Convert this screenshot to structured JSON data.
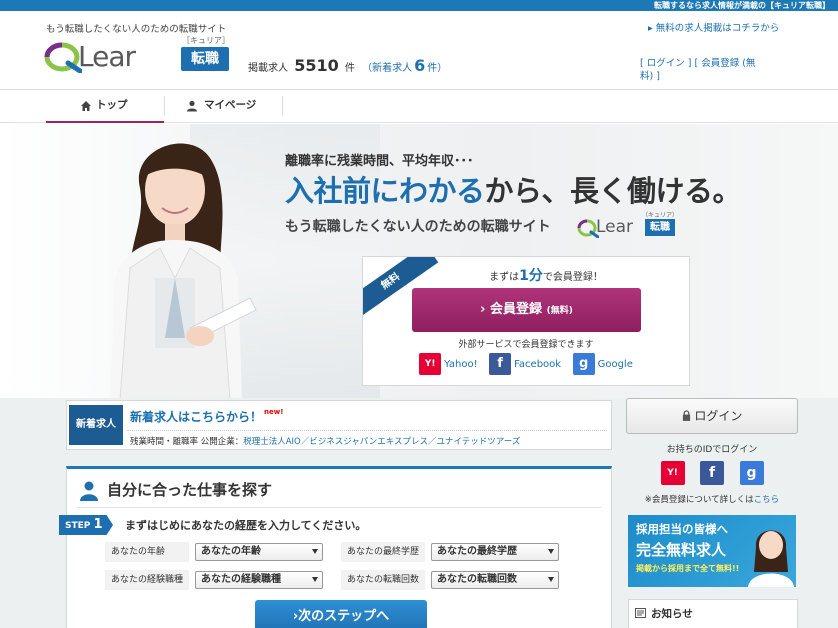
{
  "topbar": {
    "text": "転職するなら求人情報が満載の【キュリア転職】"
  },
  "header": {
    "tagline": "もう転職したくない人のための転職サイト",
    "logo_text": "Lear",
    "logo_kana": "［キュリア］",
    "logo_badge": "転職",
    "jobs_label": "掲載求人",
    "jobs_count": "5510",
    "jobs_unit": "件",
    "new_prefix": "（新着求人",
    "new_count": "6",
    "new_suffix": "件）",
    "post_link": "無料の求人掲載はコチラから",
    "login_link": "[ ログイン ] [ 会員登録 (無料) ]"
  },
  "nav": {
    "items": [
      {
        "label": "トップ",
        "icon": "home-icon"
      },
      {
        "label": "マイページ",
        "icon": "user-icon"
      }
    ]
  },
  "hero": {
    "line1": "離職率に残業時間、平均年収･･･",
    "line2_accent": "入社前にわかる",
    "line2_rest": "から、長く働ける。",
    "line3": "もう転職したくない人のための転職サイト",
    "logo_text": "Lear",
    "logo_kana": "（キュリア）",
    "logo_badge": "転職"
  },
  "registration": {
    "ribbon": "無料",
    "intro_before": "まずは",
    "intro_accent": "1分",
    "intro_after": "で会員登録！",
    "button_label": "会員登録",
    "button_small": "(無料)",
    "external_caption": "外部サービスで会員登録できます",
    "external": [
      {
        "name": "Yahoo!",
        "icon": "yahoo-icon",
        "glyph": "Y!",
        "color": "#e60033"
      },
      {
        "name": "Facebook",
        "icon": "facebook-icon",
        "glyph": "f",
        "color": "#3b5998"
      },
      {
        "name": "Google",
        "icon": "google-icon",
        "glyph": "g",
        "color": "#3a7ad9"
      }
    ]
  },
  "news": {
    "tag": "新着求人",
    "title": "新着求人はこちらから！",
    "new_badge": "new!",
    "detail_prefix": "残業時間・離職率 公開企業：",
    "companies": "税理士法人AIO／ビジネスジャパンエキスプレス／ユナイテッドツアーズ"
  },
  "search": {
    "title": "自分に合った仕事を探す",
    "step_label": "STEP",
    "step_num": "1",
    "step_text": "まずはじめにあなたの経歴を入力してください。",
    "fields": [
      {
        "label": "あなたの年齢",
        "value": "あなたの年齢"
      },
      {
        "label": "あなたの最終学歴",
        "value": "あなたの最終学歴"
      },
      {
        "label": "あなたの経験職種",
        "value": "あなたの経験職種"
      },
      {
        "label": "あなたの転職回数",
        "value": "あなたの転職回数"
      }
    ],
    "next_label": "次のステップへ"
  },
  "sidebar": {
    "login_label": "ログイン",
    "id_caption": "お持ちのIDでログイン",
    "note_text": "※会員登録について詳しくは",
    "note_link": "こちら",
    "recruit_line1": "採用担当の皆様へ",
    "recruit_line2": "完全無料求人",
    "recruit_line3": "掲載から採用まで全て無料!!",
    "notice_title": "お知らせ"
  },
  "colors": {
    "brand_blue": "#1d6fb0",
    "accent_magenta": "#a3215f",
    "yahoo": "#e60033",
    "facebook": "#3b5998",
    "google": "#3a7ad9"
  }
}
